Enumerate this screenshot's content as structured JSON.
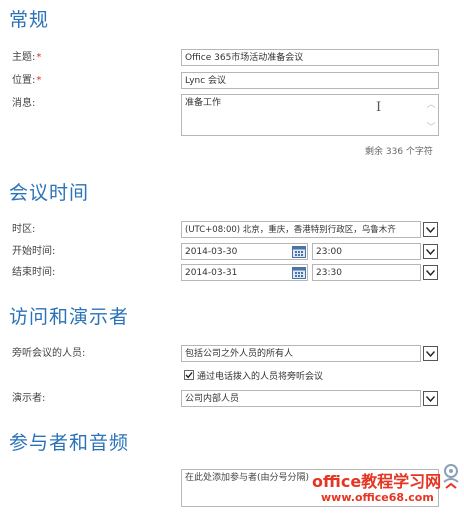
{
  "sections": {
    "general": "常规",
    "meeting_time": "会议时间",
    "access": "访问和演示者",
    "participants": "参与者和音频"
  },
  "fields": {
    "subject_label": "主题:",
    "subject_value": "Office 365市场活动准备会议",
    "location_label": "位置:",
    "location_value": "Lync 会议",
    "message_label": "消息:",
    "message_value": "准备工作",
    "required_marker": "*",
    "char_counter": "剩余 336 个字符",
    "timezone_label": "时区:",
    "timezone_value": "(UTC+08:00) 北京，重庆，香港特别行政区，乌鲁木齐",
    "start_label": "开始时间:",
    "start_date": "2014-03-30",
    "start_time": "23:00",
    "end_label": "结束时间:",
    "end_date": "2014-03-31",
    "end_time": "23:30",
    "attendees_label": "旁听会议的人员:",
    "attendees_value": "包括公司之外人员的所有人",
    "phone_checkbox_label": "通过电话拨入的人员将旁听会议",
    "phone_checkbox_checked": true,
    "presenters_label": "演示者:",
    "presenters_value": "公司内部人员",
    "participants_placeholder": "在此处添加参与者(由分号分隔)"
  },
  "watermark": {
    "title": "office教程学习网",
    "url": "www.office68.com"
  },
  "colors": {
    "heading": "#2b73b8",
    "required": "#d0302f",
    "watermark": "#e53523"
  }
}
